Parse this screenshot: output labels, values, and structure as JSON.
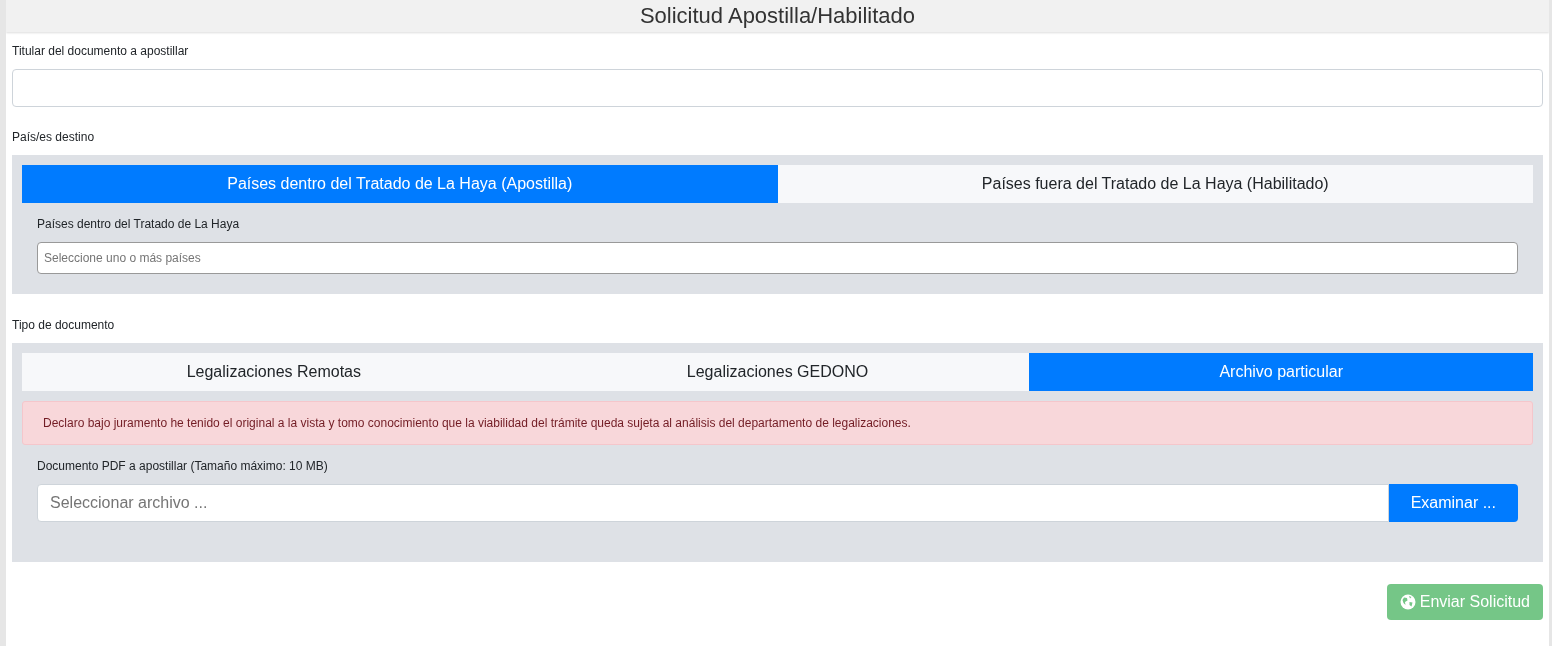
{
  "title": "Solicitud Apostilla/Habilitado",
  "holder": {
    "label": "Titular del documento a apostillar"
  },
  "destination": {
    "label": "País/es destino",
    "tabs": [
      {
        "label": "Países dentro del Tratado de La Haya (Apostilla)",
        "selected": true
      },
      {
        "label": "Países fuera del Tratado de La Haya (Habilitado)",
        "selected": false
      }
    ],
    "field_label": "Países dentro del Tratado de La Haya",
    "placeholder": "Seleccione uno o más países"
  },
  "doc_type": {
    "label": "Tipo de documento",
    "tabs": [
      {
        "label": "Legalizaciones Remotas",
        "selected": false
      },
      {
        "label": "Legalizaciones GEDONO",
        "selected": false
      },
      {
        "label": "Archivo particular",
        "selected": true
      }
    ],
    "alert": "Declaro bajo juramento he tenido el original a la vista y tomo conocimiento que la viabilidad del trámite queda sujeta al análisis del departamento de legalizaciones.",
    "file_label": "Documento PDF a apostillar (Tamaño máximo: 10 MB)",
    "file_placeholder": "Seleccionar archivo ...",
    "browse": "Examinar ..."
  },
  "submit": {
    "label": "Enviar Solicitud",
    "disabled": true
  }
}
